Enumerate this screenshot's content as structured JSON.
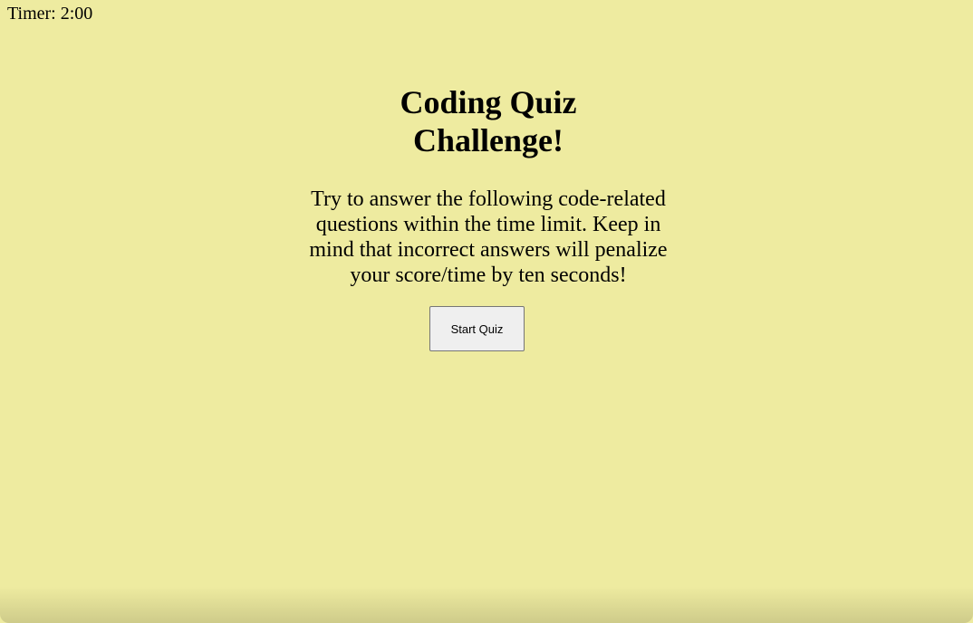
{
  "timer": {
    "text": "Timer: 2:00"
  },
  "intro": {
    "title": "Coding Quiz Challenge!",
    "description": "Try to answer the following code-related questions within the time limit. Keep in mind that incorrect answers will penalize your score/time by ten seconds!"
  },
  "start_button": {
    "label": "Start Quiz"
  },
  "colors": {
    "background": "#eeeba0",
    "button_background": "#efefef",
    "button_border": "#767676"
  }
}
